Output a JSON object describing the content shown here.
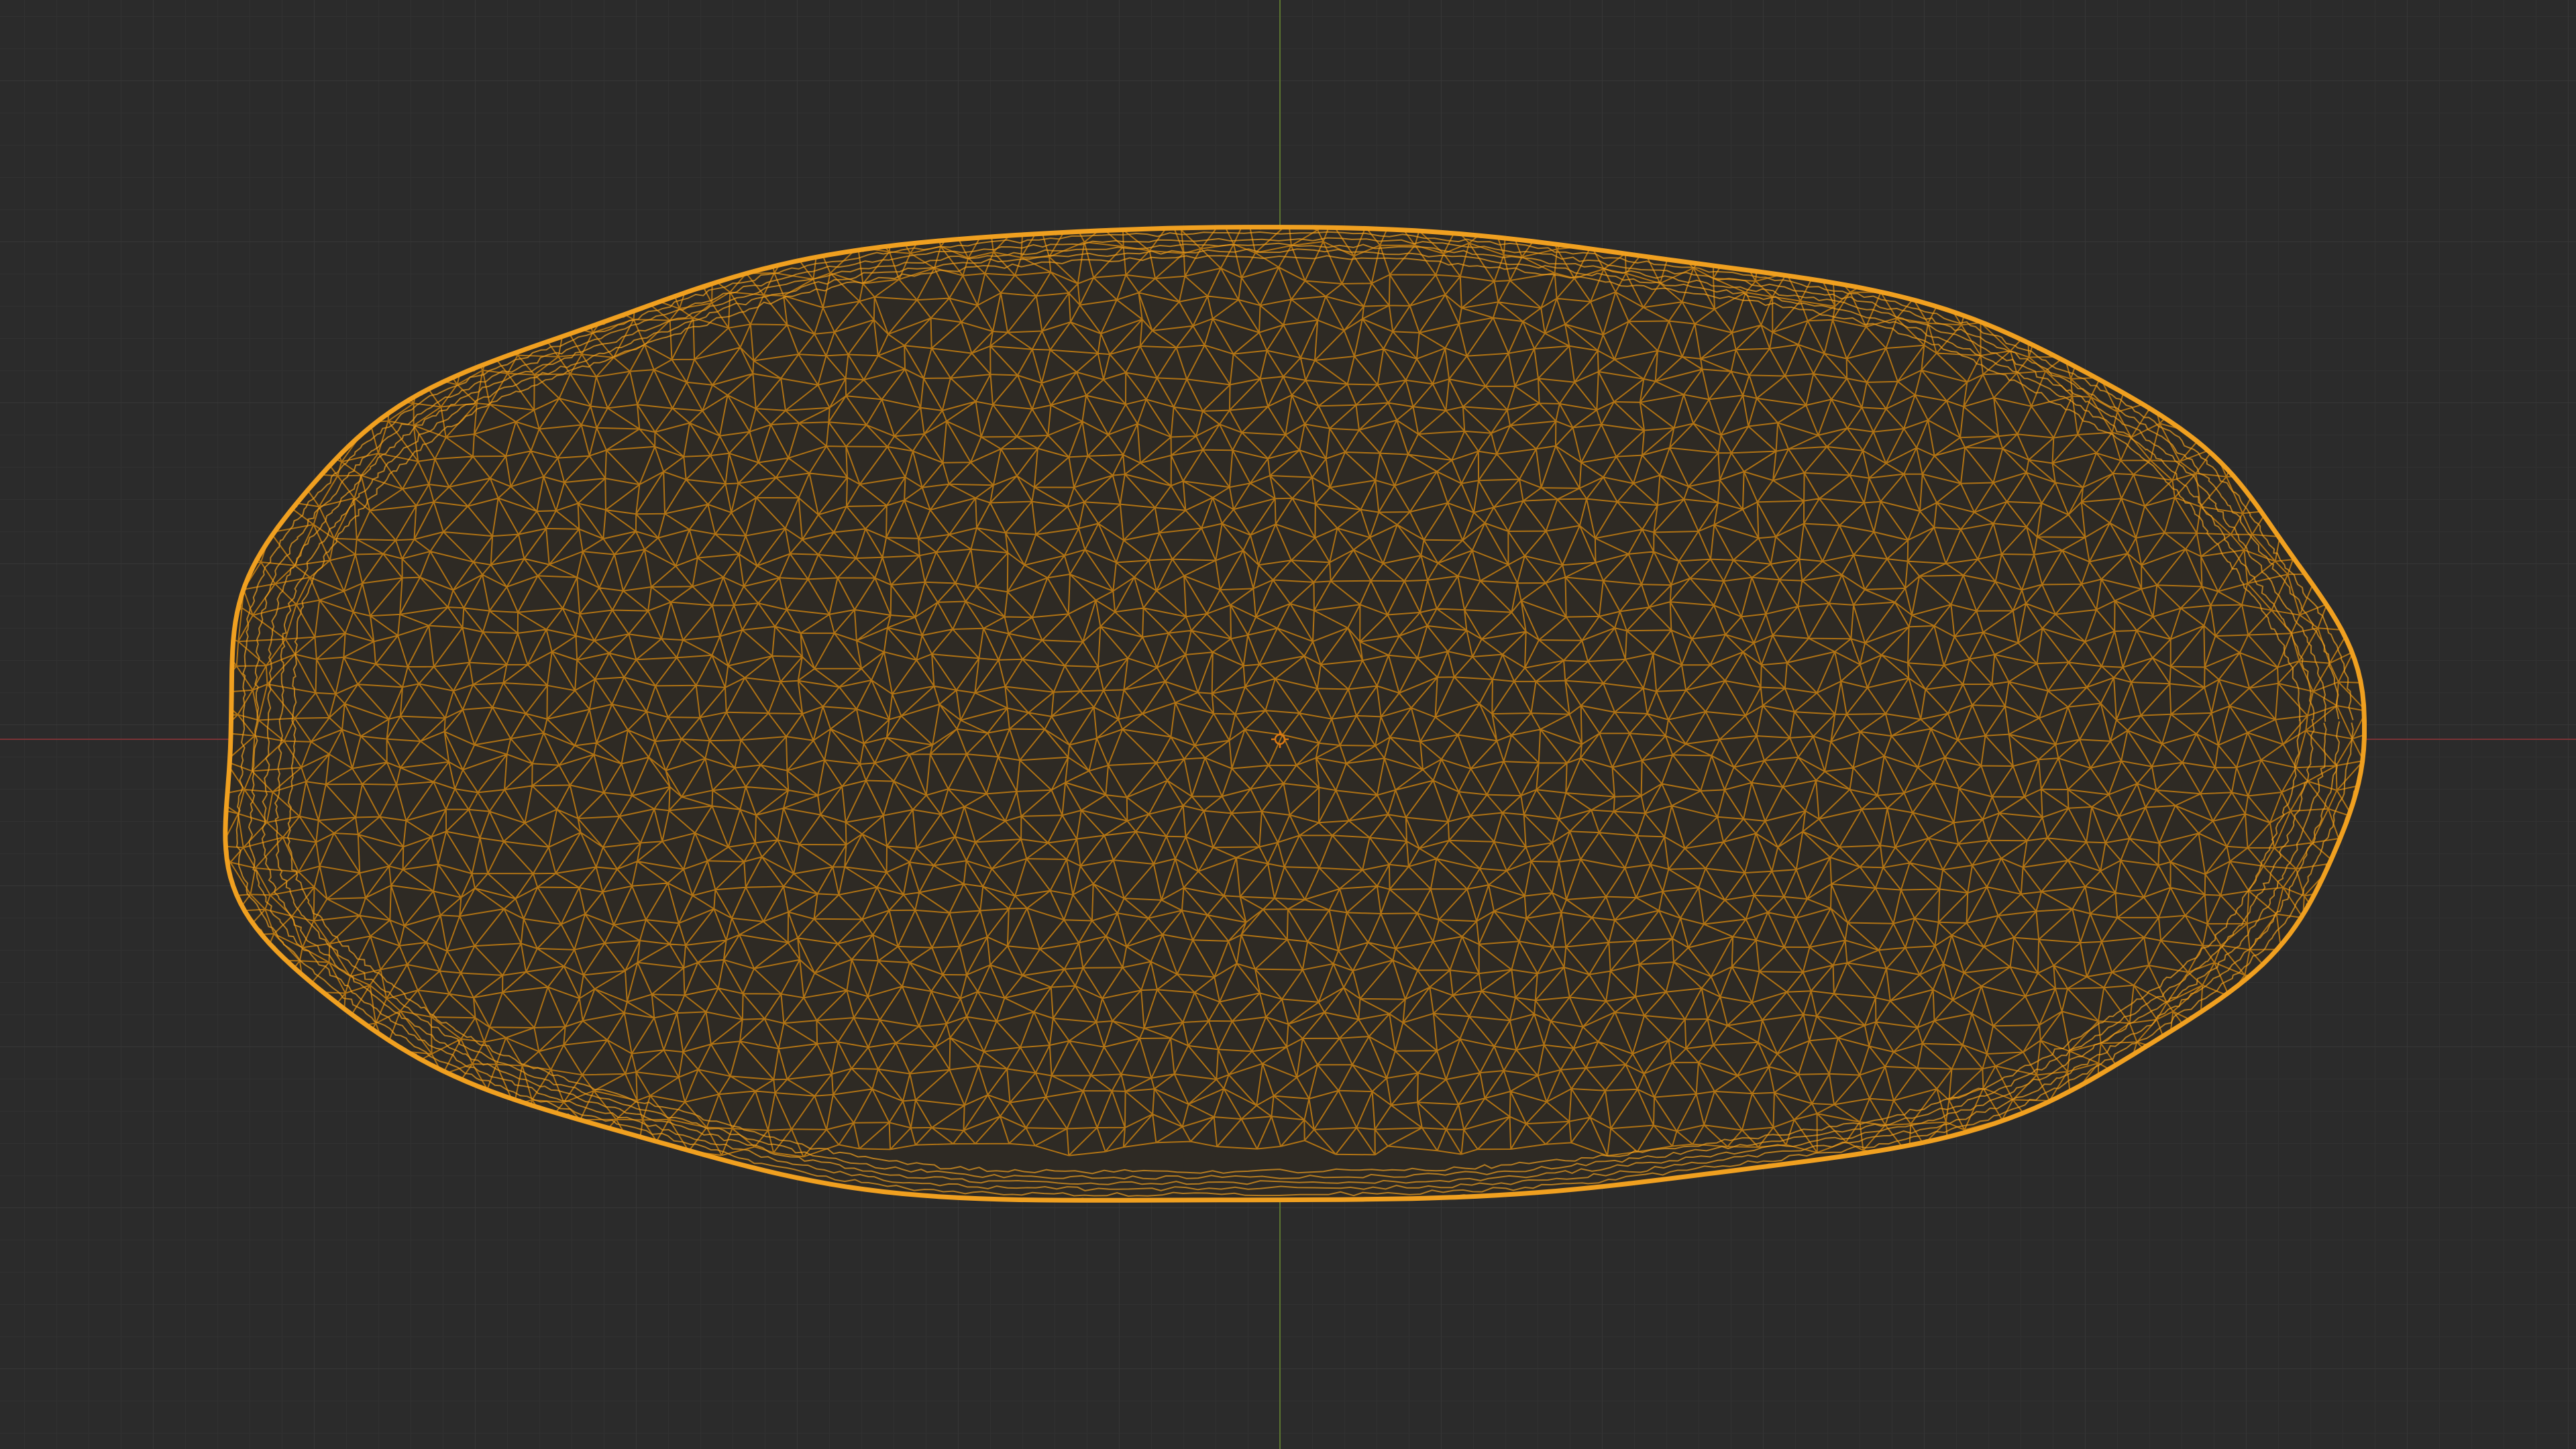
{
  "viewport": {
    "type": "3d-viewport",
    "shading_mode": "wireframe",
    "view": "orthographic-top",
    "background_color": "#2b2b2b",
    "grid": {
      "visible": true,
      "minor_line_color": "#313131",
      "major_line_color": "#363636",
      "x_axis_color": "#7a3336",
      "y_axis_color": "#5b7430"
    },
    "selected_object": {
      "shape": "elongated-ellipsoid",
      "selected": true,
      "wire_color": "#d4860f",
      "outline_color": "#f0a020"
    },
    "origin_marker": {
      "icon": "object-origin-icon",
      "color": "#e07a12"
    }
  }
}
